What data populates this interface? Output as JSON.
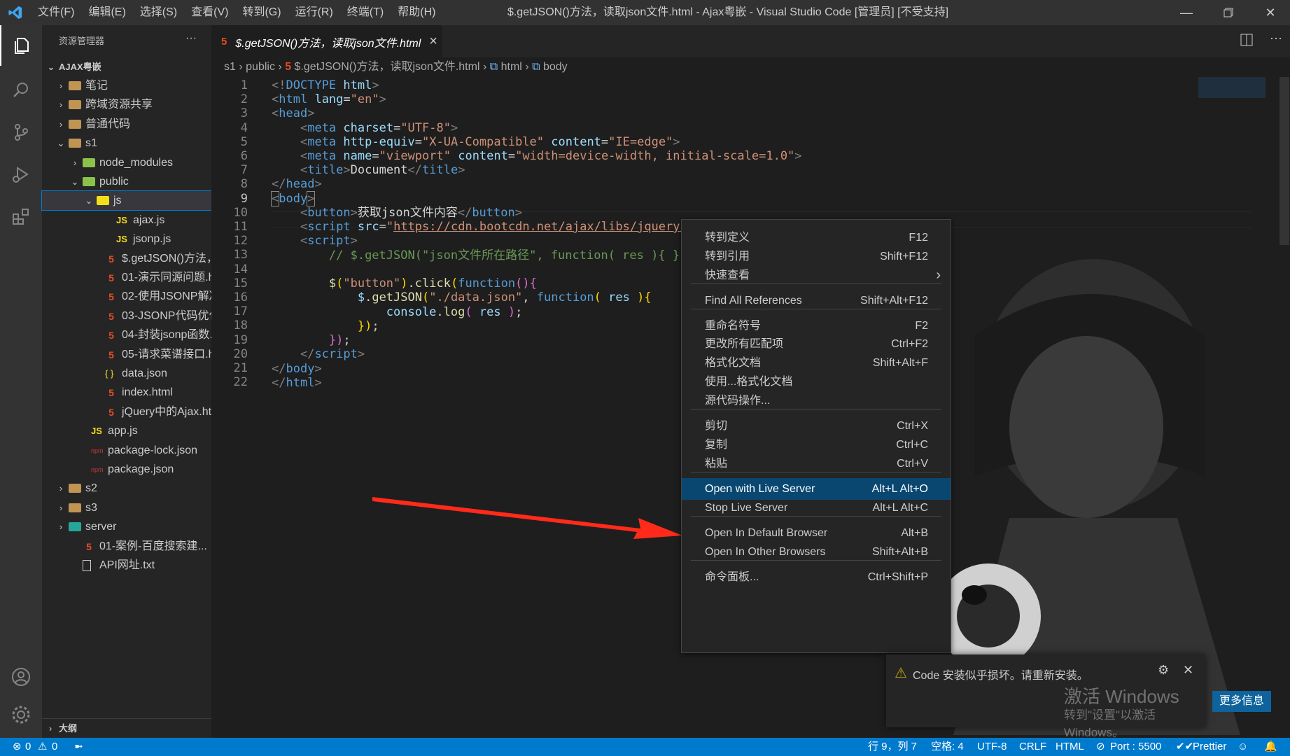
{
  "titlebar": {
    "menus": [
      "文件(F)",
      "编辑(E)",
      "选择(S)",
      "查看(V)",
      "转到(G)",
      "运行(R)",
      "终端(T)",
      "帮助(H)"
    ],
    "title": "$.getJSON()方法，读取json文件.html - Ajax粤嵌 - Visual Studio Code [管理员] [不受支持]"
  },
  "sidebar": {
    "header": "资源管理器",
    "more": "···",
    "root": "AJAX粤嵌",
    "outline": "大纲",
    "items": [
      {
        "label": "笔记"
      },
      {
        "label": "跨域资源共享"
      },
      {
        "label": "普通代码"
      },
      {
        "label": "s1"
      },
      {
        "label": "node_modules"
      },
      {
        "label": "public"
      },
      {
        "label": "js"
      },
      {
        "label": "ajax.js"
      },
      {
        "label": "jsonp.js"
      },
      {
        "label": "$.getJSON()方法，..."
      },
      {
        "label": "01-演示同源问题.h..."
      },
      {
        "label": "02-使用JSONP解决..."
      },
      {
        "label": "03-JSONP代码优化..."
      },
      {
        "label": "04-封装jsonp函数...."
      },
      {
        "label": "05-请求菜谱接口.h..."
      },
      {
        "label": "data.json"
      },
      {
        "label": "index.html"
      },
      {
        "label": "jQuery中的Ajax.html"
      },
      {
        "label": "app.js"
      },
      {
        "label": "package-lock.json"
      },
      {
        "label": "package.json"
      },
      {
        "label": "s2"
      },
      {
        "label": "s3"
      },
      {
        "label": "server"
      },
      {
        "label": "01-案例-百度搜索建..."
      },
      {
        "label": "API网址.txt"
      }
    ]
  },
  "tab": {
    "label": "$.getJSON()方法，读取json文件.html",
    "close": "×"
  },
  "breadcrumb": {
    "p1": "s1",
    "p2": "public",
    "p3": "$.getJSON()方法，读取json文件.html",
    "p4": "html",
    "p5": "body",
    "sep": "›"
  },
  "editor": {
    "lines": [
      "1",
      "2",
      "3",
      "4",
      "5",
      "6",
      "7",
      "8",
      "9",
      "10",
      "11",
      "12",
      "13",
      "14",
      "15",
      "16",
      "17",
      "18",
      "19",
      "20",
      "21",
      "22"
    ]
  },
  "context_menu": {
    "items": [
      {
        "label": "转到定义",
        "key": "F12"
      },
      {
        "label": "转到引用",
        "key": "Shift+F12"
      },
      {
        "label": "快速查看",
        "key": "›"
      },
      {
        "label": "Find All References",
        "key": "Shift+Alt+F12"
      },
      {
        "label": "重命名符号",
        "key": "F2"
      },
      {
        "label": "更改所有匹配项",
        "key": "Ctrl+F2"
      },
      {
        "label": "格式化文档",
        "key": "Shift+Alt+F"
      },
      {
        "label": "使用...格式化文档",
        "key": ""
      },
      {
        "label": "源代码操作...",
        "key": ""
      },
      {
        "label": "剪切",
        "key": "Ctrl+X"
      },
      {
        "label": "复制",
        "key": "Ctrl+C"
      },
      {
        "label": "粘贴",
        "key": "Ctrl+V"
      },
      {
        "label": "Open with Live Server",
        "key": "Alt+L Alt+O"
      },
      {
        "label": "Stop Live Server",
        "key": "Alt+L Alt+C"
      },
      {
        "label": "Open In Default Browser",
        "key": "Alt+B"
      },
      {
        "label": "Open In Other Browsers",
        "key": "Shift+Alt+B"
      },
      {
        "label": "命令面板...",
        "key": "Ctrl+Shift+P"
      }
    ]
  },
  "notification": {
    "text": "Code 安装似乎损坏。请重新安装。",
    "button": "更多信息",
    "watermark1": "激活 Windows",
    "watermark2": "转到\"设置\"以激活 Windows。"
  },
  "status": {
    "problems": "0",
    "warnings": "0",
    "position": "行 9，列 7",
    "spaces": "空格: 4",
    "encoding": "UTF-8",
    "eol": "CRLF",
    "language": "HTML",
    "port": "Port : 5500",
    "prettier": "Prettier"
  },
  "colors": {
    "accent": "#007acc",
    "selected": "#094771",
    "arrow": "#ff2a1a"
  }
}
